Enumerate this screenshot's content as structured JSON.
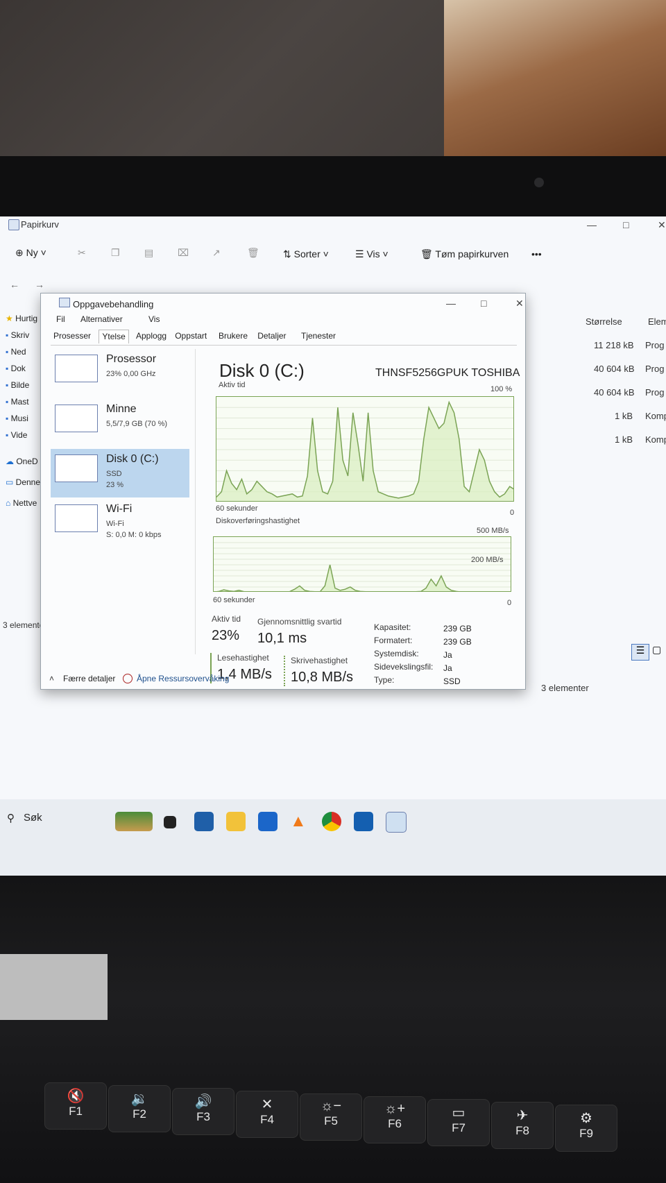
{
  "explorer": {
    "title": "Papirkurv",
    "window_controls": {
      "minimize": "—",
      "maximize": "□",
      "close": "✕"
    },
    "toolbar": {
      "new_label": "Ny",
      "sort_label": "Sorter",
      "view_label": "Vis",
      "empty_bin_label": "Tøm papirkurven",
      "more": "•••"
    },
    "nav": {
      "quick_access": "Hurtig",
      "items": [
        "Skriv",
        "Ned",
        "Dok",
        "Bilde",
        "Mast",
        "Musi",
        "Vide"
      ],
      "onedrive": "OneD",
      "this_pc": "Denne",
      "network": "Nettve"
    },
    "columns": {
      "size": "Størrelse",
      "type": "Elem"
    },
    "rows": [
      {
        "size": "11 218 kB",
        "type": "Prog"
      },
      {
        "size": "40 604 kB",
        "type": "Prog"
      },
      {
        "size": "40 604 kB",
        "type": "Prog"
      },
      {
        "size": "1 kB",
        "type": "Komp"
      },
      {
        "size": "1 kB",
        "type": "Komp"
      }
    ],
    "status_left": "3 elementer",
    "status_right": "3 elementer"
  },
  "task_manager": {
    "title": "Oppgavebehandling",
    "window_controls": {
      "minimize": "—",
      "maximize": "□",
      "close": "✕"
    },
    "menu": [
      "Fil",
      "Alternativer",
      "Vis"
    ],
    "tabs": [
      "Prosesser",
      "Ytelse",
      "Applogg",
      "Oppstart",
      "Brukere",
      "Detaljer",
      "Tjenester"
    ],
    "active_tab": "Ytelse",
    "resources": [
      {
        "name": "Prosessor",
        "line1": "23% 0,00 GHz",
        "line2": ""
      },
      {
        "name": "Minne",
        "line1": "5,5/7,9 GB (70 %)",
        "line2": ""
      },
      {
        "name": "Disk 0 (C:)",
        "line1": "SSD",
        "line2": "23 %"
      },
      {
        "name": "Wi-Fi",
        "line1": "Wi-Fi",
        "line2": "S: 0,0 M: 0 kbps"
      }
    ],
    "disk": {
      "title": "Disk 0 (C:)",
      "model": "THNSF5256GPUK TOSHIBA",
      "active_label": "Aktiv tid",
      "active_max": "100 %",
      "active_time_axis": "60 sekunder",
      "active_min": "0",
      "transfer_label": "Diskoverføringshastighet",
      "transfer_max": "500 MB/s",
      "transfer_mid": "200 MB/s",
      "transfer_time_axis": "60 sekunder",
      "transfer_min": "0",
      "stats": {
        "active_time_label": "Aktiv tid",
        "active_time_value": "23%",
        "avg_response_label": "Gjennomsnittlig svartid",
        "avg_response_value": "10,1 ms",
        "read_label": "Lesehastighet",
        "read_value": "1,4 MB/s",
        "write_label": "Skrivehastighet",
        "write_value": "10,8 MB/s"
      },
      "properties": [
        {
          "label": "Kapasitet:",
          "value": "239 GB"
        },
        {
          "label": "Formatert:",
          "value": "239 GB"
        },
        {
          "label": "Systemdisk:",
          "value": "Ja"
        },
        {
          "label": "Sidevekslingsfil:",
          "value": "Ja"
        },
        {
          "label": "Type:",
          "value": "SSD"
        }
      ]
    },
    "footer": {
      "fewer_details": "Færre detaljer",
      "open_monitor": "Åpne Ressursovervåking"
    }
  },
  "taskbar": {
    "search_label": "Søk"
  },
  "keyboard": {
    "keys": [
      {
        "fn": "F1",
        "glyph": "🔇"
      },
      {
        "fn": "F2",
        "glyph": "🔉"
      },
      {
        "fn": "F3",
        "glyph": "🔊"
      },
      {
        "fn": "F4",
        "glyph": "✕"
      },
      {
        "fn": "F5",
        "glyph": "☼−"
      },
      {
        "fn": "F6",
        "glyph": "☼+"
      },
      {
        "fn": "F7",
        "glyph": "▭"
      },
      {
        "fn": "F8",
        "glyph": "✈"
      },
      {
        "fn": "F9",
        "glyph": "⚙"
      }
    ]
  },
  "chart_data": [
    {
      "type": "area",
      "title": "Aktiv tid",
      "x": [
        0,
        1,
        2,
        3,
        4,
        5,
        6,
        7,
        8,
        9,
        10,
        11,
        12,
        13,
        14,
        15,
        16,
        17,
        18,
        19,
        20,
        21,
        22,
        23,
        24,
        25,
        26,
        27,
        28,
        29,
        30,
        31,
        32,
        33,
        34,
        35,
        36,
        37,
        38,
        39,
        40,
        41,
        42,
        43,
        44,
        45,
        46,
        47,
        48,
        49,
        50,
        51,
        52,
        53,
        54,
        55,
        56,
        57,
        58,
        59
      ],
      "values": [
        5,
        10,
        30,
        18,
        12,
        22,
        8,
        12,
        20,
        15,
        10,
        8,
        5,
        6,
        7,
        8,
        5,
        6,
        25,
        80,
        30,
        10,
        8,
        20,
        90,
        40,
        25,
        85,
        55,
        20,
        85,
        30,
        10,
        8,
        6,
        5,
        4,
        5,
        6,
        8,
        20,
        60,
        90,
        80,
        70,
        75,
        95,
        85,
        60,
        15,
        10,
        30,
        50,
        40,
        20,
        10,
        5,
        8,
        15,
        12
      ],
      "ylim": [
        0,
        100
      ],
      "xlabel": "60 sekunder",
      "color": "#7aa354"
    },
    {
      "type": "line",
      "title": "Diskoverføringshastighet",
      "x": [
        0,
        1,
        2,
        3,
        4,
        5,
        6,
        7,
        8,
        9,
        10,
        11,
        12,
        13,
        14,
        15,
        16,
        17,
        18,
        19,
        20,
        21,
        22,
        23,
        24,
        25,
        26,
        27,
        28,
        29,
        30,
        31,
        32,
        33,
        34,
        35,
        36,
        37,
        38,
        39,
        40,
        41,
        42,
        43,
        44,
        45,
        46,
        47,
        48,
        49,
        50,
        51,
        52,
        53,
        54,
        55,
        56,
        57,
        58,
        59
      ],
      "values": [
        5,
        10,
        25,
        15,
        10,
        20,
        8,
        5,
        4,
        3,
        3,
        4,
        5,
        3,
        4,
        8,
        30,
        60,
        20,
        10,
        8,
        5,
        60,
        250,
        40,
        20,
        30,
        50,
        20,
        10,
        8,
        5,
        3,
        3,
        3,
        2,
        3,
        4,
        5,
        6,
        8,
        10,
        40,
        120,
        60,
        150,
        50,
        20,
        10,
        5,
        3,
        2,
        3,
        2,
        2,
        3,
        2,
        2,
        3,
        2
      ],
      "ylim": [
        0,
        500
      ],
      "xlabel": "60 sekunder",
      "color": "#7aa354"
    }
  ]
}
